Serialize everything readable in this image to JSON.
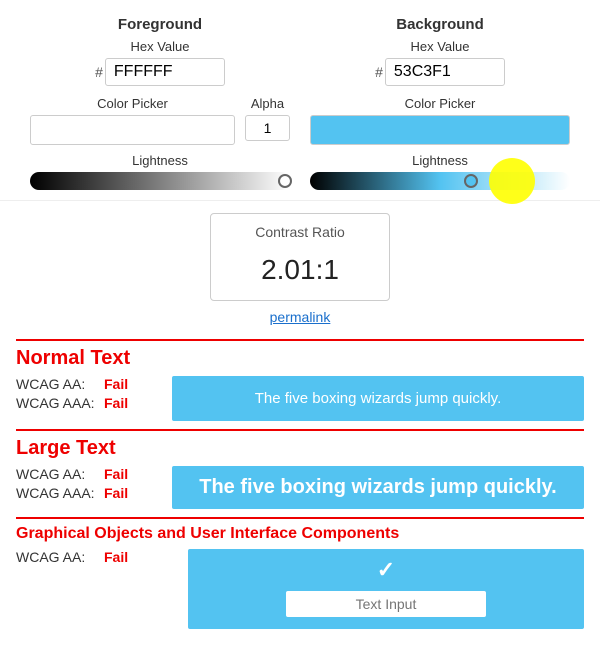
{
  "foreground": {
    "title": "Foreground",
    "hex_label": "Hex Value",
    "hash": "#",
    "hex_value": "FFFFFF",
    "picker_label": "Color Picker",
    "alpha_label": "Alpha",
    "alpha_value": "1",
    "lightness_label": "Lightness",
    "swatch_color": "#FFFFFF",
    "thumb_position_pct": 98
  },
  "background": {
    "title": "Background",
    "hex_label": "Hex Value",
    "hash": "#",
    "hex_value": "53C3F1",
    "picker_label": "Color Picker",
    "lightness_label": "Lightness",
    "swatch_color": "#53C3F1",
    "thumb_position_pct": 62
  },
  "contrast": {
    "label": "Contrast Ratio",
    "value": "2.01",
    "suffix": ":1",
    "permalink_label": "permalink"
  },
  "normal_text": {
    "title": "Normal Text",
    "divider": true,
    "wcag_aa_label": "WCAG AA:",
    "wcag_aa_result": "Fail",
    "wcag_aaa_label": "WCAG AAA:",
    "wcag_aaa_result": "Fail",
    "preview_text": "The five boxing wizards jump quickly."
  },
  "large_text": {
    "title": "Large Text",
    "wcag_aa_label": "WCAG AA:",
    "wcag_aa_result": "Fail",
    "wcag_aaa_label": "WCAG AAA:",
    "wcag_aaa_result": "Fail",
    "preview_text": "The five boxing wizards jump quickly."
  },
  "graphical": {
    "title": "Graphical Objects and User Interface Components",
    "wcag_aa_label": "WCAG AA:",
    "wcag_aa_result": "Fail",
    "checkmark": "✓",
    "text_input_placeholder": "Text Input"
  }
}
